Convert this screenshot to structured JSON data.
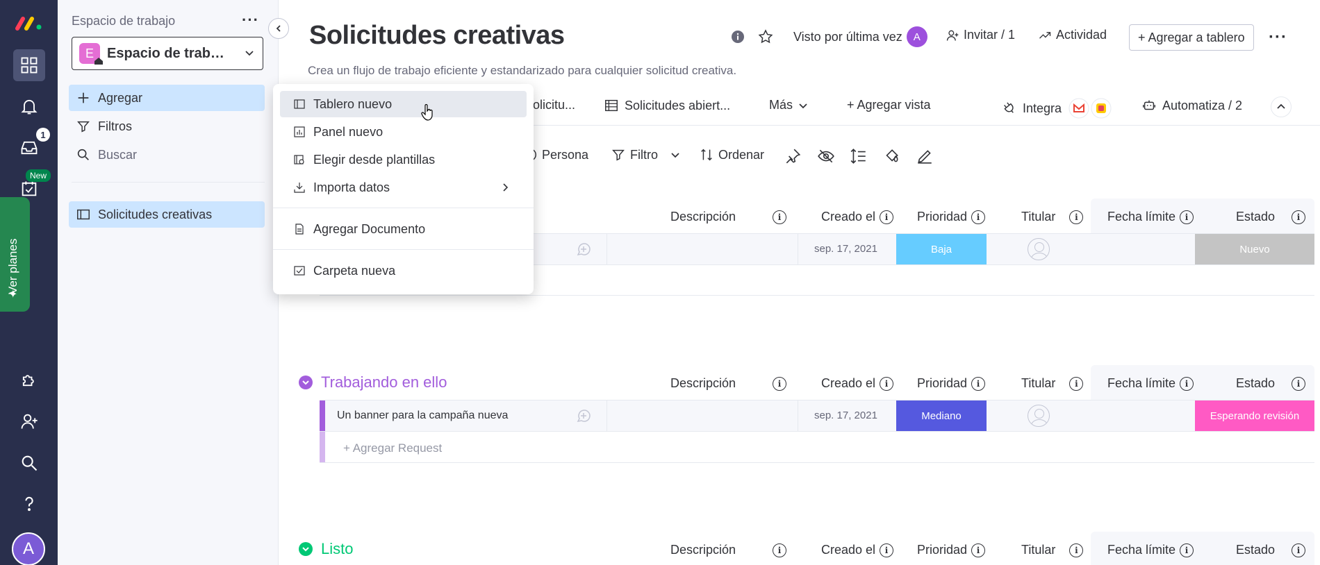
{
  "workspace": {
    "label": "Espacio de trabajo",
    "selector_initial": "E",
    "selector_name": "Espacio de trab…",
    "add": "Agregar",
    "filters": "Filtros",
    "search": "Buscar",
    "board_item": "Solicitudes creativas"
  },
  "rail": {
    "inbox_count": "1",
    "new_badge": "New",
    "plans_tab": "Ver planes",
    "user_initial": "A"
  },
  "board": {
    "title": "Solicitudes creativas",
    "description": "Crea un flujo de trabajo eficiente y estandarizado para cualquier solicitud creativa.",
    "last_seen": "Visto por última vez",
    "last_seen_avatar": "A",
    "invite": "Invitar / 1",
    "activity": "Actividad",
    "add_to_board": "+ Agregar a tablero"
  },
  "views": {
    "tab1": "olicitu...",
    "tab2": "Solicitudes abiert...",
    "more": "Más",
    "add_view": "+ Agregar vista",
    "integrate": "Integra",
    "automate": "Automatiza / 2"
  },
  "toolbar": {
    "person": "Persona",
    "filter": "Filtro",
    "sort": "Ordenar"
  },
  "columns": {
    "description": "Descripción",
    "created": "Creado el",
    "priority": "Prioridad",
    "owner": "Titular",
    "due": "Fecha límite",
    "status": "Estado"
  },
  "groups": [
    {
      "rows": [
        {
          "name": "",
          "created": "sep. 17, 2021",
          "priority": "Baja",
          "priority_color": "#66ccff",
          "status": "Nuevo",
          "status_color": "#c4c4c4"
        }
      ]
    },
    {
      "title": "Trabajando en ello",
      "color": "#a25ddc",
      "rows": [
        {
          "name": "Un banner para la campaña nueva",
          "created": "sep. 17, 2021",
          "priority": "Mediano",
          "priority_color": "#5559df",
          "status": "Esperando revisión",
          "status_color": "#ff5ac4"
        }
      ],
      "add_row": "+ Agregar Request"
    },
    {
      "title": "Listo",
      "color": "#00c875"
    }
  ],
  "menu": {
    "items": [
      "Tablero nuevo",
      "Panel nuevo",
      "Elegir desde plantillas",
      "Importa datos",
      "Agregar Documento",
      "Carpeta nueva"
    ]
  }
}
